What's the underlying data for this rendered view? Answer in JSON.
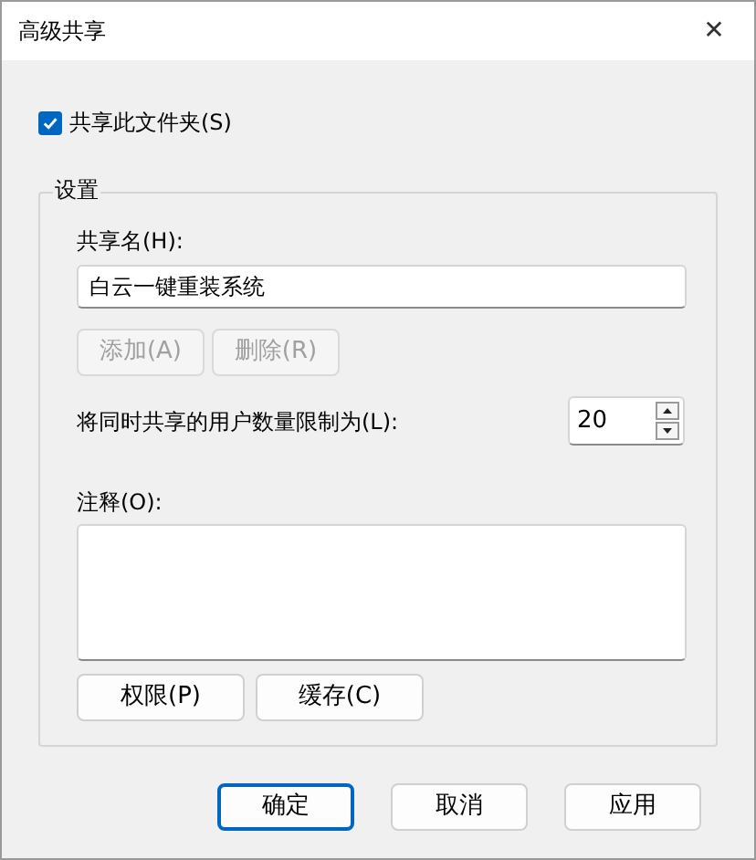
{
  "window": {
    "title": "高级共享",
    "close": "✕"
  },
  "share_checkbox": {
    "label": "共享此文件夹(S)",
    "checked": true
  },
  "settings": {
    "title": "设置",
    "share_name": {
      "label": "共享名(H):",
      "value": "白云一键重装系统"
    },
    "name_buttons": [
      {
        "label": "添加(A)",
        "disabled": true
      },
      {
        "label": "删除(R)",
        "disabled": true
      }
    ],
    "user_limit": {
      "label": "将同时共享的用户数量限制为(L):",
      "value": "20"
    },
    "comment": {
      "label": "注释(O):"
    },
    "buttons": [
      {
        "label": "权限(P)"
      },
      {
        "label": "缓存(C)"
      }
    ]
  },
  "footer_buttons": [
    {
      "label": "确定",
      "primary": true
    },
    {
      "label": "取消",
      "primary": false
    },
    {
      "label": "应用",
      "primary": false
    }
  ]
}
